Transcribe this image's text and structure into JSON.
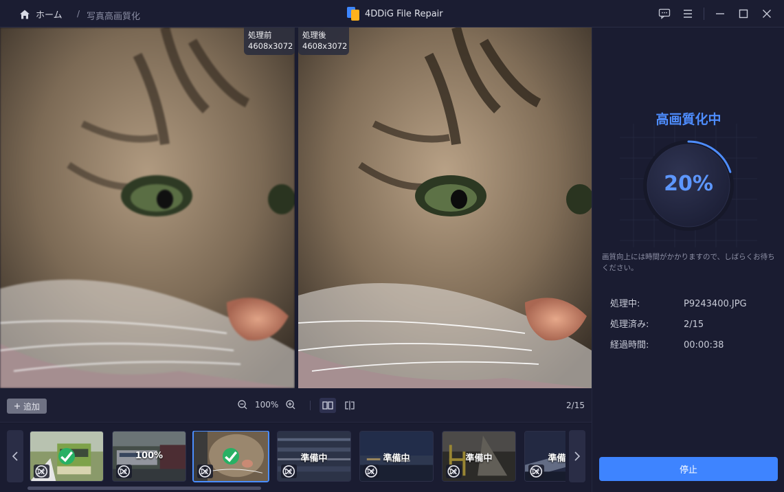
{
  "titlebar": {
    "home_label": "ホーム",
    "separator": "/",
    "breadcrumb": "写真高画質化",
    "app_title": "4DDiG File Repair"
  },
  "preview": {
    "before_label": "処理前",
    "before_size": "4608x3072",
    "after_label": "処理後",
    "after_size": "4608x3072"
  },
  "toolbar": {
    "add_label": "追加",
    "zoom_value": "100%",
    "counter": "2/15"
  },
  "thumbnails": [
    {
      "status": "",
      "scale": "1x",
      "done": true
    },
    {
      "status": "100%",
      "scale": "1x",
      "done": false
    },
    {
      "status": "",
      "scale": "1x",
      "done": true
    },
    {
      "status": "準備中",
      "scale": "1x",
      "done": false
    },
    {
      "status": "準備中",
      "scale": "1x",
      "done": false
    },
    {
      "status": "準備中",
      "scale": "1x",
      "done": false
    },
    {
      "status": "準備中",
      "scale": "1x",
      "done": false
    }
  ],
  "panel": {
    "title": "高画質化中",
    "percent": "20%",
    "progress_fraction": 0.2,
    "note": "画質向上には時間がかかりますので、しばらくお待ちください。",
    "processing_label": "処理中:",
    "processing_value": "P9243400.JPG",
    "done_label": "処理済み:",
    "done_value": "2/15",
    "elapsed_label": "経過時間:",
    "elapsed_value": "00:00:38",
    "stop_label": "停止"
  },
  "colors": {
    "accent": "#3e84ff",
    "success": "#28b064",
    "background": "#151729"
  },
  "icons": [
    "home-icon",
    "feedback-icon",
    "menu-icon",
    "minimize-icon",
    "maximize-icon",
    "close-icon",
    "zoom-out-icon",
    "zoom-in-icon",
    "side-by-side-icon",
    "split-compare-icon",
    "plus-icon",
    "check-icon",
    "scale-icon",
    "chevron-left-icon",
    "chevron-right-icon"
  ]
}
